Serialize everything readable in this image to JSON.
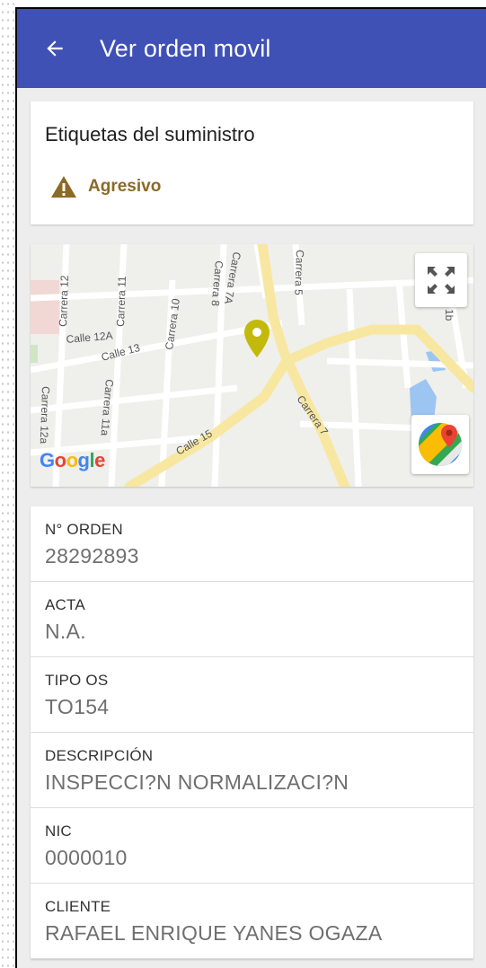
{
  "appbar": {
    "title": "Ver orden movil",
    "back_icon": "arrow-left-icon",
    "color": "#3f51b5"
  },
  "labels_card": {
    "title": "Etiquetas del suministro",
    "tag": {
      "label": "Agresivo",
      "icon": "warning-icon",
      "color": "#8b6a25"
    }
  },
  "map": {
    "streets": [
      "Carrera 12",
      "Carrera 11",
      "Carrera 10",
      "Carrera 8",
      "Carrera 7A",
      "Carrera 5",
      "Calle 12A",
      "Calle 13",
      "Carrera 12a",
      "Carrera 11a",
      "Calle 15",
      "Carrera 7",
      "1b"
    ],
    "logo": [
      "G",
      "o",
      "o",
      "g",
      "l",
      "e"
    ],
    "fullscreen_icon": "fullscreen-icon",
    "open_maps_icon": "google-maps-icon",
    "pin_icon": "map-pin-icon",
    "pin_color": "#c3b90b"
  },
  "details": [
    {
      "label": "N° ORDEN",
      "value": "28292893"
    },
    {
      "label": "ACTA",
      "value": "N.A."
    },
    {
      "label": "TIPO OS",
      "value": "TO154"
    },
    {
      "label": "DESCRIPCIÓN",
      "value": "INSPECCI?N NORMALIZACI?N"
    },
    {
      "label": "NIC",
      "value": "0000010"
    },
    {
      "label": "CLIENTE",
      "value": "RAFAEL ENRIQUE YANES OGAZA"
    }
  ]
}
